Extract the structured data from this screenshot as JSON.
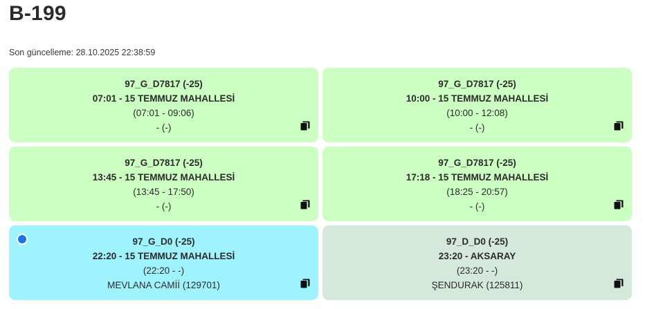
{
  "page": {
    "title": "B-199",
    "updated": "Son güncelleme: 28.10.2025 22:38:59"
  },
  "cards": [
    {
      "code": "97_G_D7817 (-25)",
      "route": "07:01 - 15 TEMMUZ MAHALLESİ",
      "times": "(07:01 - 09:06)",
      "stop": "- (-)",
      "state": "green",
      "selected": false,
      "copy_icon": "copy-icon"
    },
    {
      "code": "97_G_D7817 (-25)",
      "route": "10:00 - 15 TEMMUZ MAHALLESİ",
      "times": "(10:00 - 12:08)",
      "stop": "- (-)",
      "state": "green",
      "selected": false,
      "copy_icon": "copy-icon"
    },
    {
      "code": "97_G_D7817 (-25)",
      "route": "13:45 - 15 TEMMUZ MAHALLESİ",
      "times": "(13:45 - 17:50)",
      "stop": "- (-)",
      "state": "green",
      "selected": false,
      "copy_icon": "copy-icon"
    },
    {
      "code": "97_G_D7817 (-25)",
      "route": "17:18 - 15 TEMMUZ MAHALLESİ",
      "times": "(18:25 - 20:57)",
      "stop": "- (-)",
      "state": "green",
      "selected": false,
      "copy_icon": "copy-icon"
    },
    {
      "code": "97_G_D0 (-25)",
      "route": "22:20 - 15 TEMMUZ MAHALLESİ",
      "times": "(22:20 - -)",
      "stop": "MEVLANA CAMİİ (129701)",
      "state": "blue",
      "selected": true,
      "copy_icon": "copy-icon"
    },
    {
      "code": "97_D_D0 (-25)",
      "route": "23:20 - AKSARAY",
      "times": "(23:20 - -)",
      "stop": "ŞENDURAK (125811)",
      "state": "grey",
      "selected": false,
      "copy_icon": "copy-icon"
    }
  ],
  "colors": {
    "green": "#ccffc2",
    "blue": "#9ef3ff",
    "grey": "#d5e8dc",
    "selected_dot": "#1a73e8"
  }
}
